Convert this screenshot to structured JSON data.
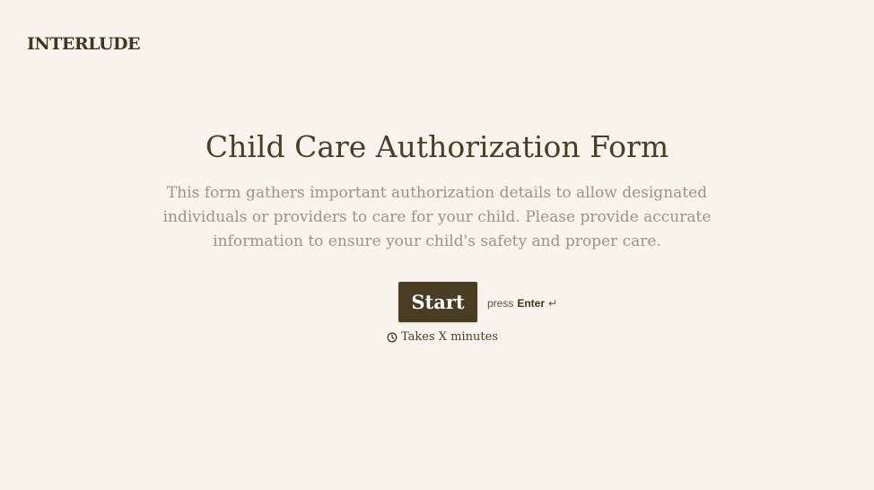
{
  "brand": {
    "logo_text": "INTERLUDE"
  },
  "form": {
    "title": "Child Care Authorization Form",
    "description": "This form gathers important authorization details to allow designated individuals or providers to care for your child. Please provide accurate information to ensure your child's safety and proper care.",
    "start_label": "Start",
    "hint_prefix": "press",
    "hint_key": "Enter",
    "hint_icon": "↵",
    "duration_text": "Takes X minutes"
  },
  "colors": {
    "background": "#f8f3ec",
    "primary": "#483e24",
    "title_text": "#4a3f24",
    "description_text": "#9c9383"
  },
  "icons": {
    "enter": "enter-key-icon",
    "duration": "clock-icon"
  }
}
